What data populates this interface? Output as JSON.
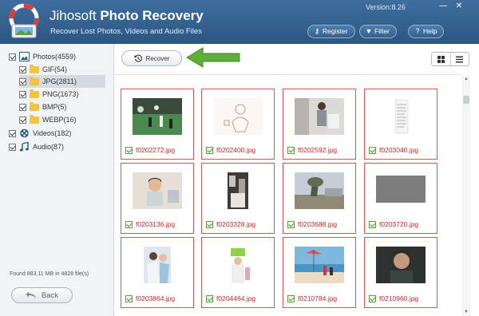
{
  "app": {
    "title_light": "Jihosoft",
    "title_bold": "Photo Recovery",
    "subtitle": "Recover Lost Photos, Videos and Audio Files",
    "version": "Version:8.26"
  },
  "header_buttons": {
    "register": "Register",
    "filter": "Filter",
    "help": "Help"
  },
  "sidebar": {
    "photos": "Photos(4559)",
    "gif": "GIF(54)",
    "jpg": "JPG(2811)",
    "png": "PNG(1673)",
    "bmp": "BMP(5)",
    "webp": "WEBP(16)",
    "videos": "Videos(182)",
    "audio": "Audio(87)",
    "found": "Found 883.11 MB in 4828 file(s)",
    "back": "Back"
  },
  "toolbar": {
    "recover": "Recover"
  },
  "files": [
    "f0202272.jpg",
    "f0202400.jpg",
    "f0202592.jpg",
    "f0203040.jpg",
    "f0203136.jpg",
    "f0203328.jpg",
    "f0203688.jpg",
    "f0203720.jpg",
    "f0203864.jpg",
    "f0204464.jpg",
    "f0210784.jpg",
    "f0210960.jpg"
  ],
  "colors": {
    "header": "#33608d",
    "card_border": "#e35050",
    "filename": "#c62828",
    "arrow": "#5fae3a"
  }
}
